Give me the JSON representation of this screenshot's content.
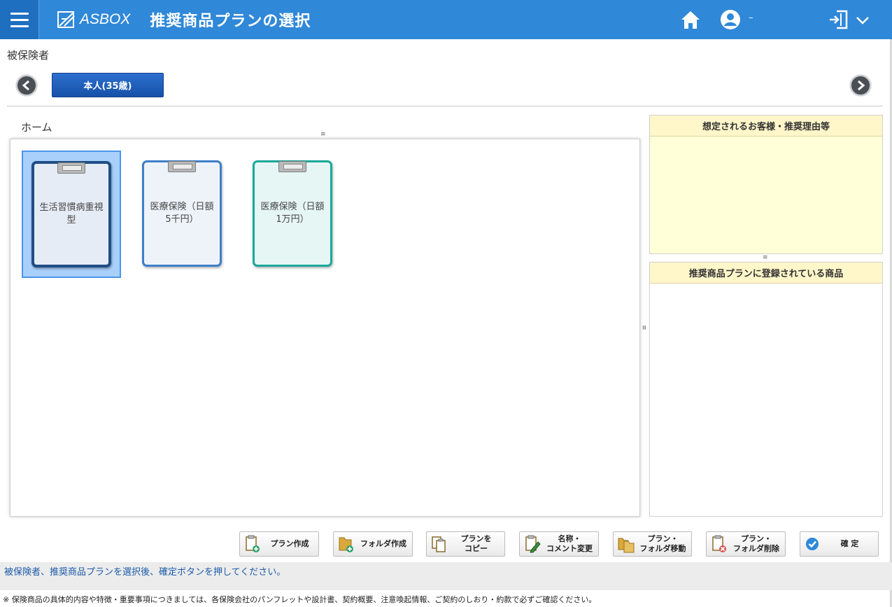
{
  "header": {
    "logo_text": "ASBOX",
    "title": "推奨商品プランの選択",
    "user_name": "–",
    "icons": [
      "menu-icon",
      "home-icon",
      "user-icon",
      "logout-icon",
      "chevron-down-icon"
    ]
  },
  "insured": {
    "label": "被保険者",
    "tabs": [
      {
        "label": "本人(35歳)",
        "selected": true
      }
    ]
  },
  "folder": {
    "breadcrumb": "ホーム",
    "plans": [
      {
        "label": "生活習慣病重視型",
        "color": "#1f4e86",
        "fill": "#e6ecf5",
        "selected": true
      },
      {
        "label": "医療保険（日額5千円）",
        "color": "#3f7fc9",
        "fill": "#eef3fa",
        "selected": false
      },
      {
        "label": "医療保険（日額1万円）",
        "color": "#1aa89a",
        "fill": "#e6f6f5",
        "selected": false
      }
    ]
  },
  "side": {
    "reason_header": "想定されるお客様・推奨理由等",
    "products_header": "推奨商品プランに登録されている商品"
  },
  "toolbar": {
    "create_plan": "プラン作成",
    "create_folder": "フォルダ作成",
    "copy_plan_1": "プランを",
    "copy_plan_2": "コピー",
    "rename_1": "名称・",
    "rename_2": "コメント変更",
    "move_1": "プラン・",
    "move_2": "フォルダ移動",
    "delete_1": "プラン・",
    "delete_2": "フォルダ削除",
    "confirm": "確 定"
  },
  "status": "被保険者、推奨商品プランを選択後、確定ボタンを押してください。",
  "footer": "※ 保険商品の具体的内容や特徴・重要事項につきましては、各保険会社のパンフレットや設計書、契約概要、注意喚起情報、ご契約のしおり・約款で必ずご確認ください。"
}
